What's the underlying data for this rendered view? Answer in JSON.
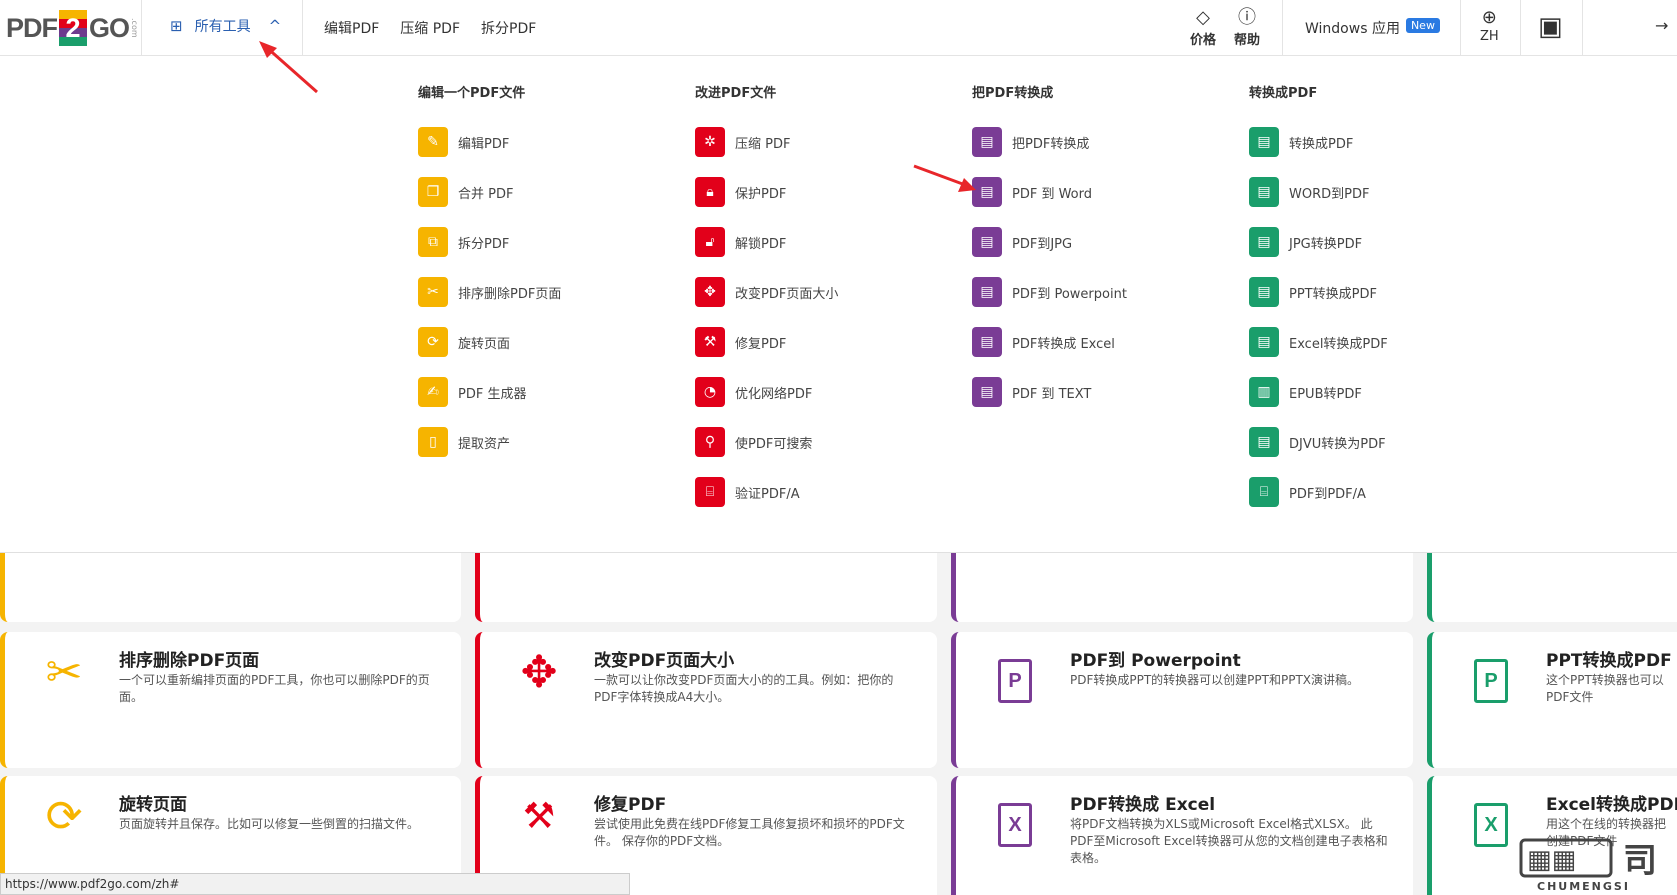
{
  "header": {
    "logo": {
      "pdf": "PDF",
      "two": "2",
      "go": "GO",
      "com": ".com"
    },
    "all_tools_label": "所有工具",
    "nav": [
      "编辑PDF",
      "压缩 PDF",
      "拆分PDF"
    ],
    "price_label": "价格",
    "help_label": "帮助",
    "windows_app_label": "Windows 应用",
    "new_badge": "New",
    "lang_label": "ZH"
  },
  "menu": {
    "columns": [
      {
        "title": "编辑一个PDF文件",
        "color": "#f6b400",
        "items": [
          {
            "label": "编辑PDF",
            "icon": "edit-icon"
          },
          {
            "label": "合并 PDF",
            "icon": "merge-icon"
          },
          {
            "label": "拆分PDF",
            "icon": "split-icon"
          },
          {
            "label": "排序删除PDF页面",
            "icon": "scissors-icon"
          },
          {
            "label": "旋转页面",
            "icon": "rotate-icon"
          },
          {
            "label": "PDF 生成器",
            "icon": "create-icon"
          },
          {
            "label": "提取资产",
            "icon": "extract-icon"
          }
        ]
      },
      {
        "title": "改进PDF文件",
        "color": "#e2001a",
        "items": [
          {
            "label": "压缩 PDF",
            "icon": "compress-icon"
          },
          {
            "label": "保护PDF",
            "icon": "lock-icon"
          },
          {
            "label": "解锁PDF",
            "icon": "unlock-icon"
          },
          {
            "label": "改变PDF页面大小",
            "icon": "move-icon"
          },
          {
            "label": "修复PDF",
            "icon": "wrench-icon"
          },
          {
            "label": "优化网络PDF",
            "icon": "gauge-icon"
          },
          {
            "label": "使PDF可搜索",
            "icon": "search-icon"
          },
          {
            "label": "验证PDF/A",
            "icon": "archive-icon"
          }
        ]
      },
      {
        "title": "把PDF转换成",
        "color": "#7a3c95",
        "items": [
          {
            "label": "把PDF转换成",
            "icon": "pdf-file-icon"
          },
          {
            "label": "PDF 到 Word",
            "icon": "word-file-icon"
          },
          {
            "label": "PDF到JPG",
            "icon": "image-file-icon"
          },
          {
            "label": "PDF到 Powerpoint",
            "icon": "ppt-file-icon"
          },
          {
            "label": "PDF转换成 Excel",
            "icon": "excel-file-icon"
          },
          {
            "label": "PDF 到 TEXT",
            "icon": "text-file-icon"
          }
        ]
      },
      {
        "title": "转换成PDF",
        "color": "#1a9e6b",
        "items": [
          {
            "label": "转换成PDF",
            "icon": "pdf-file-icon"
          },
          {
            "label": "WORD到PDF",
            "icon": "word-file-icon"
          },
          {
            "label": "JPG转换PDF",
            "icon": "image-file-icon"
          },
          {
            "label": "PPT转换成PDF",
            "icon": "ppt-file-icon"
          },
          {
            "label": "Excel转换成PDF",
            "icon": "excel-file-icon"
          },
          {
            "label": "EPUB转PDF",
            "icon": "book-icon"
          },
          {
            "label": "DJVU转换为PDF",
            "icon": "djvu-file-icon"
          },
          {
            "label": "PDF到PDF/A",
            "icon": "archive-icon"
          }
        ]
      }
    ]
  },
  "cards": {
    "row1": [
      {
        "title": "排序删除PDF页面",
        "desc": "一个可以重新编排页面的PDF工具，你也可以删除PDF的页面。",
        "glyph": "✂"
      },
      {
        "title": "改变PDF页面大小",
        "desc": "一款可以让你改变PDF页面大小的的工具。例如：把你的PDF字体转换成A4大小。",
        "glyph": "✥"
      },
      {
        "title": "PDF到 Powerpoint",
        "desc": "PDF转换成PPT的转换器可以创建PPT和PPTX演讲稿。",
        "glyph": "P"
      },
      {
        "title": "PPT转换成PDF",
        "desc": "这个PPT转换器也可以\nPDF文件",
        "glyph": "P"
      }
    ],
    "row2": [
      {
        "title": "旋转页面",
        "desc": "页面旋转并且保存。比如可以修复一些倒置的扫描文件。",
        "glyph": "⟳"
      },
      {
        "title": "修复PDF",
        "desc": "尝试使用此免费在线PDF修复工具修复损坏和损坏的PDF文件。 保存你的PDF文档。",
        "glyph": "🔧"
      },
      {
        "title": "PDF转换成 Excel",
        "desc": "将PDF文档转换为XLS或Microsoft Excel格式XLSX。 此PDF至Microsoft Excel转换器可从您的文档创建电子表格和表格。",
        "glyph": "X"
      },
      {
        "title": "Excel转换成PDF",
        "desc": "用这个在线的转换器把\n创建PDF文件",
        "glyph": "X"
      }
    ]
  },
  "status_url": "https://www.pdf2go.com/zh#",
  "watermark": {
    "text": "CHUMENGSI"
  }
}
